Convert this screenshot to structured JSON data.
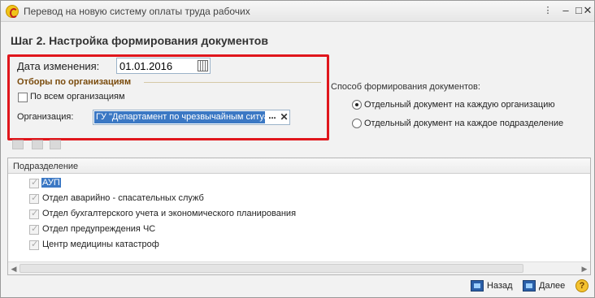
{
  "window": {
    "title": "Перевод на новую систему оплаты труда рабочих",
    "controls": {
      "more": "⋮",
      "minimize": "–",
      "maximize": "□",
      "close": "✕"
    }
  },
  "step_title": "Шаг 2. Настройка формирования документов",
  "change_date": {
    "label": "Дата изменения:",
    "value": "01.01.2016",
    "icon": "calendar-icon"
  },
  "org_filter": {
    "group_title": "Отборы по организациям",
    "all_orgs_label": "По всем организациям",
    "all_orgs_checked": false,
    "org_label": "Организация:",
    "org_value": "ГУ \"Департамент по чрезвычайным ситуациям",
    "select_button": "...",
    "clear_button": "✕"
  },
  "method": {
    "title": "Способ формирования документов:",
    "options": [
      {
        "label": "Отдельный документ на каждую организацию",
        "selected": true
      },
      {
        "label": "Отдельный документ на каждое подразделение",
        "selected": false
      }
    ]
  },
  "toolbar_icons": [
    "check-all-icon",
    "uncheck-all-icon",
    "invert-check-icon"
  ],
  "table": {
    "header": "Подразделение",
    "rows": [
      {
        "label": "АУП",
        "checked": true,
        "selected": true
      },
      {
        "label": "Отдел аварийно - спасательных служб",
        "checked": true,
        "selected": false
      },
      {
        "label": "Отдел бухгалтерского учета и экономического планирования",
        "checked": true,
        "selected": false
      },
      {
        "label": "Отдел предупреждения ЧС",
        "checked": true,
        "selected": false
      },
      {
        "label": "Центр медицины катастроф",
        "checked": true,
        "selected": false
      }
    ]
  },
  "footer": {
    "back_label": "Назад",
    "next_label": "Далее",
    "help_label": "?"
  },
  "colors": {
    "highlight": "#e0161c",
    "selection": "#3b78c4",
    "group_title": "#7a4b0c"
  }
}
